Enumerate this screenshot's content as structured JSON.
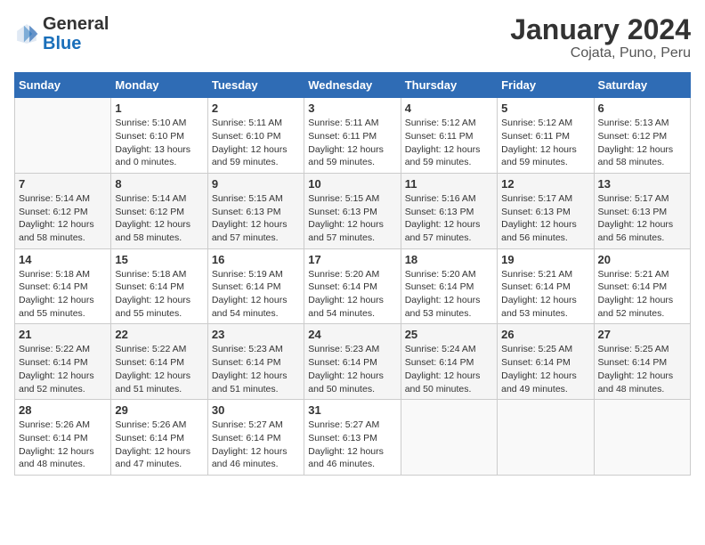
{
  "header": {
    "logo_general": "General",
    "logo_blue": "Blue",
    "title": "January 2024",
    "subtitle": "Cojata, Puno, Peru"
  },
  "columns": [
    "Sunday",
    "Monday",
    "Tuesday",
    "Wednesday",
    "Thursday",
    "Friday",
    "Saturday"
  ],
  "weeks": [
    [
      {
        "day": "",
        "info": ""
      },
      {
        "day": "1",
        "info": "Sunrise: 5:10 AM\nSunset: 6:10 PM\nDaylight: 13 hours\nand 0 minutes."
      },
      {
        "day": "2",
        "info": "Sunrise: 5:11 AM\nSunset: 6:10 PM\nDaylight: 12 hours\nand 59 minutes."
      },
      {
        "day": "3",
        "info": "Sunrise: 5:11 AM\nSunset: 6:11 PM\nDaylight: 12 hours\nand 59 minutes."
      },
      {
        "day": "4",
        "info": "Sunrise: 5:12 AM\nSunset: 6:11 PM\nDaylight: 12 hours\nand 59 minutes."
      },
      {
        "day": "5",
        "info": "Sunrise: 5:12 AM\nSunset: 6:11 PM\nDaylight: 12 hours\nand 59 minutes."
      },
      {
        "day": "6",
        "info": "Sunrise: 5:13 AM\nSunset: 6:12 PM\nDaylight: 12 hours\nand 58 minutes."
      }
    ],
    [
      {
        "day": "7",
        "info": "Sunrise: 5:14 AM\nSunset: 6:12 PM\nDaylight: 12 hours\nand 58 minutes."
      },
      {
        "day": "8",
        "info": "Sunrise: 5:14 AM\nSunset: 6:12 PM\nDaylight: 12 hours\nand 58 minutes."
      },
      {
        "day": "9",
        "info": "Sunrise: 5:15 AM\nSunset: 6:13 PM\nDaylight: 12 hours\nand 57 minutes."
      },
      {
        "day": "10",
        "info": "Sunrise: 5:15 AM\nSunset: 6:13 PM\nDaylight: 12 hours\nand 57 minutes."
      },
      {
        "day": "11",
        "info": "Sunrise: 5:16 AM\nSunset: 6:13 PM\nDaylight: 12 hours\nand 57 minutes."
      },
      {
        "day": "12",
        "info": "Sunrise: 5:17 AM\nSunset: 6:13 PM\nDaylight: 12 hours\nand 56 minutes."
      },
      {
        "day": "13",
        "info": "Sunrise: 5:17 AM\nSunset: 6:13 PM\nDaylight: 12 hours\nand 56 minutes."
      }
    ],
    [
      {
        "day": "14",
        "info": "Sunrise: 5:18 AM\nSunset: 6:14 PM\nDaylight: 12 hours\nand 55 minutes."
      },
      {
        "day": "15",
        "info": "Sunrise: 5:18 AM\nSunset: 6:14 PM\nDaylight: 12 hours\nand 55 minutes."
      },
      {
        "day": "16",
        "info": "Sunrise: 5:19 AM\nSunset: 6:14 PM\nDaylight: 12 hours\nand 54 minutes."
      },
      {
        "day": "17",
        "info": "Sunrise: 5:20 AM\nSunset: 6:14 PM\nDaylight: 12 hours\nand 54 minutes."
      },
      {
        "day": "18",
        "info": "Sunrise: 5:20 AM\nSunset: 6:14 PM\nDaylight: 12 hours\nand 53 minutes."
      },
      {
        "day": "19",
        "info": "Sunrise: 5:21 AM\nSunset: 6:14 PM\nDaylight: 12 hours\nand 53 minutes."
      },
      {
        "day": "20",
        "info": "Sunrise: 5:21 AM\nSunset: 6:14 PM\nDaylight: 12 hours\nand 52 minutes."
      }
    ],
    [
      {
        "day": "21",
        "info": "Sunrise: 5:22 AM\nSunset: 6:14 PM\nDaylight: 12 hours\nand 52 minutes."
      },
      {
        "day": "22",
        "info": "Sunrise: 5:22 AM\nSunset: 6:14 PM\nDaylight: 12 hours\nand 51 minutes."
      },
      {
        "day": "23",
        "info": "Sunrise: 5:23 AM\nSunset: 6:14 PM\nDaylight: 12 hours\nand 51 minutes."
      },
      {
        "day": "24",
        "info": "Sunrise: 5:23 AM\nSunset: 6:14 PM\nDaylight: 12 hours\nand 50 minutes."
      },
      {
        "day": "25",
        "info": "Sunrise: 5:24 AM\nSunset: 6:14 PM\nDaylight: 12 hours\nand 50 minutes."
      },
      {
        "day": "26",
        "info": "Sunrise: 5:25 AM\nSunset: 6:14 PM\nDaylight: 12 hours\nand 49 minutes."
      },
      {
        "day": "27",
        "info": "Sunrise: 5:25 AM\nSunset: 6:14 PM\nDaylight: 12 hours\nand 48 minutes."
      }
    ],
    [
      {
        "day": "28",
        "info": "Sunrise: 5:26 AM\nSunset: 6:14 PM\nDaylight: 12 hours\nand 48 minutes."
      },
      {
        "day": "29",
        "info": "Sunrise: 5:26 AM\nSunset: 6:14 PM\nDaylight: 12 hours\nand 47 minutes."
      },
      {
        "day": "30",
        "info": "Sunrise: 5:27 AM\nSunset: 6:14 PM\nDaylight: 12 hours\nand 46 minutes."
      },
      {
        "day": "31",
        "info": "Sunrise: 5:27 AM\nSunset: 6:13 PM\nDaylight: 12 hours\nand 46 minutes."
      },
      {
        "day": "",
        "info": ""
      },
      {
        "day": "",
        "info": ""
      },
      {
        "day": "",
        "info": ""
      }
    ]
  ]
}
